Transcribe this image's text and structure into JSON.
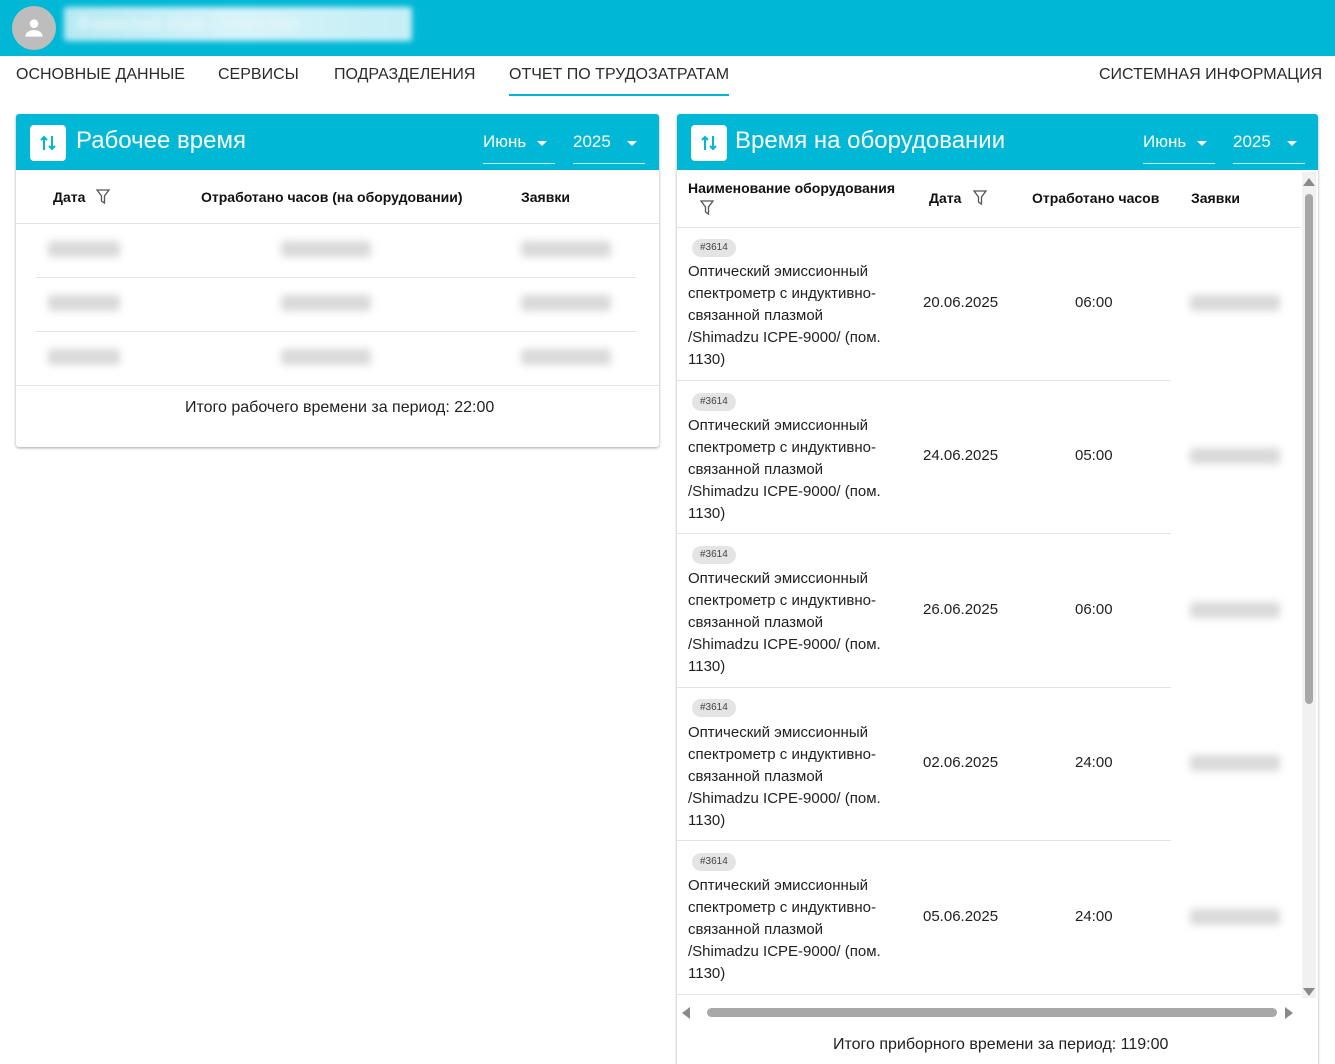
{
  "header": {
    "user_name": "Фамилия Имя Отчество"
  },
  "nav": {
    "main_data": "ОСНОВНЫЕ ДАННЫЕ",
    "services": "СЕРВИСЫ",
    "departments": "ПОДРАЗДЕЛЕНИЯ",
    "labor_report": "ОТЧЕТ ПО ТРУДОЗАТРАТАМ",
    "system_info": "СИСТЕМНАЯ ИНФОРМАЦИЯ",
    "active": "labor_report"
  },
  "colors": {
    "accent": "#00b8d6"
  },
  "work_time": {
    "title": "Рабочее время",
    "month": "Июнь",
    "year": "2025",
    "columns": {
      "date": "Дата",
      "hours": "Отработано часов (на оборудовании)",
      "requests": "Заявки"
    },
    "total": "Итого рабочего времени за период: 22:00"
  },
  "equipment_time": {
    "title": "Время на оборудовании",
    "month": "Июнь",
    "year": "2025",
    "columns": {
      "name": "Наименование оборудования",
      "date": "Дата",
      "hours": "Отработано часов",
      "requests": "Заявки"
    },
    "rows": [
      {
        "chip": "#3614",
        "name": "Оптический эмиссионный спектрометр с индуктивно-связанной плазмой /Shimadzu ICPE-9000/ (пом. 1130)",
        "date": "20.06.2025",
        "hours": "06:00"
      },
      {
        "chip": "#3614",
        "name": "Оптический эмиссионный спектрометр с индуктивно-связанной плазмой /Shimadzu ICPE-9000/ (пом. 1130)",
        "date": "24.06.2025",
        "hours": "05:00"
      },
      {
        "chip": "#3614",
        "name": "Оптический эмиссионный спектрометр с индуктивно-связанной плазмой /Shimadzu ICPE-9000/ (пом. 1130)",
        "date": "26.06.2025",
        "hours": "06:00"
      },
      {
        "chip": "#3614",
        "name": "Оптический эмиссионный спектрометр с индуктивно-связанной плазмой /Shimadzu ICPE-9000/ (пом. 1130)",
        "date": "02.06.2025",
        "hours": "24:00"
      },
      {
        "chip": "#3614",
        "name": "Оптический эмиссионный спектрометр с индуктивно-связанной плазмой /Shimadzu ICPE-9000/ (пом. 1130)",
        "date": "05.06.2025",
        "hours": "24:00"
      }
    ],
    "total": "Итого приборного времени за период: 119:00"
  }
}
